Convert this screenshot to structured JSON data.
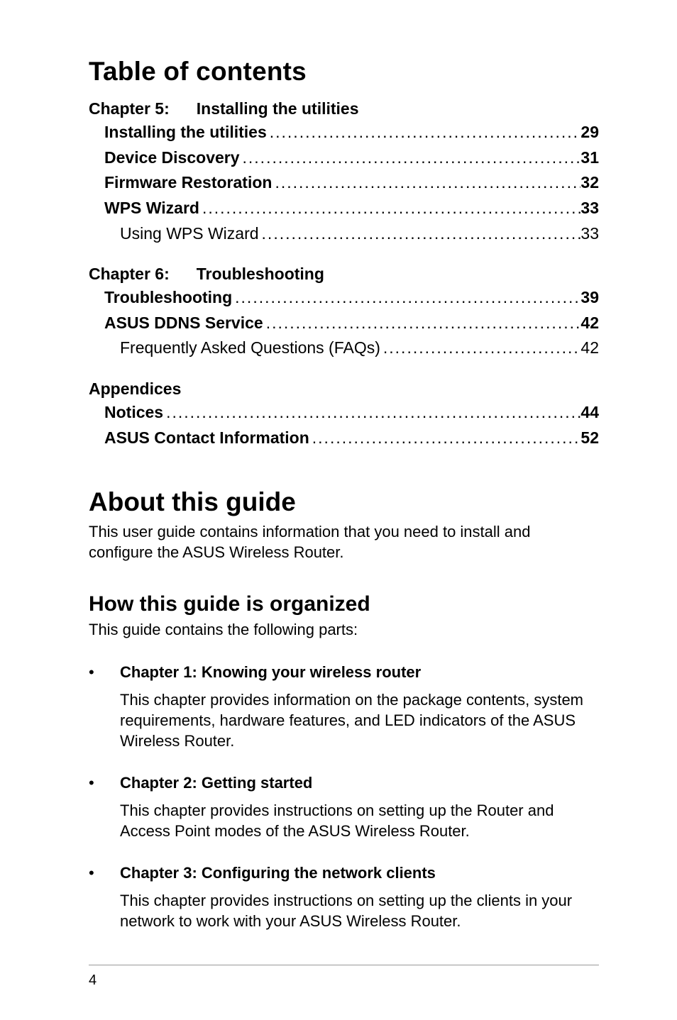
{
  "toc": {
    "title": "Table of contents",
    "dots": "........................................................................................................................................................................................",
    "sections": [
      {
        "chapter_label": "Chapter 5:",
        "chapter_title": "Installing the utilities",
        "rows": [
          {
            "label": "Installing the utilities",
            "page": "29",
            "bold": true,
            "indent": "l1"
          },
          {
            "label": "Device Discovery",
            "page": "31",
            "bold": true,
            "indent": "l1"
          },
          {
            "label": "Firmware Restoration",
            "page": "32",
            "bold": true,
            "indent": "l1"
          },
          {
            "label": "WPS Wizard",
            "page": "33",
            "bold": true,
            "indent": "l1"
          },
          {
            "label": "Using WPS Wizard",
            "page": "33",
            "bold": false,
            "indent": "sub"
          }
        ]
      },
      {
        "chapter_label": "Chapter 6:",
        "chapter_title": "Troubleshooting",
        "rows": [
          {
            "label": "Troubleshooting",
            "page": "39",
            "bold": true,
            "indent": "l1"
          },
          {
            "label": "ASUS DDNS Service",
            "page": "42",
            "bold": true,
            "indent": "l1"
          },
          {
            "label": "Frequently Asked Questions (FAQs)",
            "page": "42",
            "bold": false,
            "indent": "sub"
          }
        ]
      },
      {
        "chapter_label": "Appendices",
        "chapter_title": "",
        "rows": [
          {
            "label": "Notices",
            "page": "44",
            "bold": true,
            "indent": "l1"
          },
          {
            "label": "ASUS Contact Information",
            "page": "52",
            "bold": true,
            "indent": "l1"
          }
        ]
      }
    ]
  },
  "about": {
    "title": "About this guide",
    "intro": "This user guide contains information that you need to install and configure the ASUS Wireless Router.",
    "organized_heading": "How this guide is organized",
    "organized_intro": "This guide contains the following parts:",
    "bullets": [
      {
        "title": "Chapter 1: Knowing your wireless router",
        "body": "This chapter provides information on the package contents, system requirements, hardware features, and LED indicators of the ASUS Wireless Router."
      },
      {
        "title": "Chapter 2: Getting started",
        "body": "This chapter provides instructions on setting up the Router and Access Point modes of the ASUS Wireless Router."
      },
      {
        "title": "Chapter 3: Configuring the network clients",
        "body": "This chapter provides instructions on setting up the clients in your network to work with your ASUS Wireless Router."
      }
    ]
  },
  "footer": {
    "page_number": "4"
  },
  "bullet_mark": "•"
}
